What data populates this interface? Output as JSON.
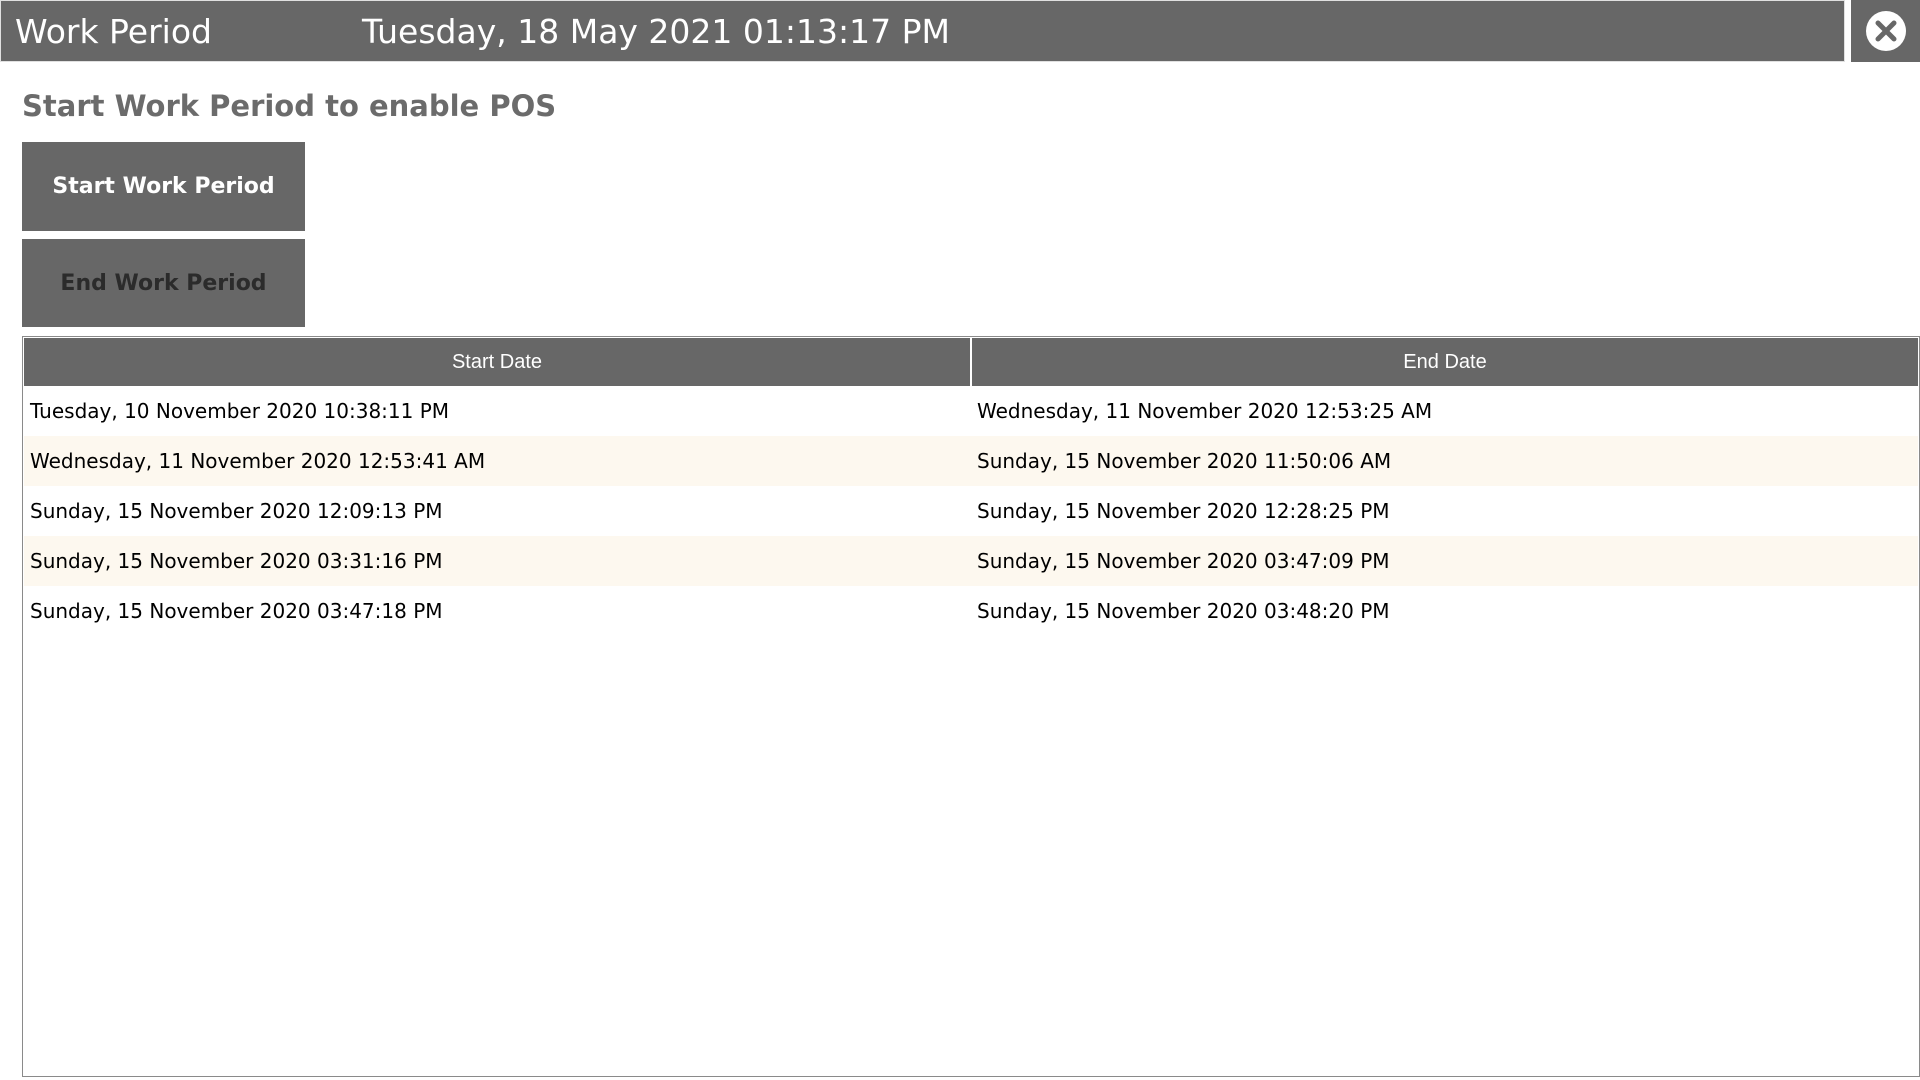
{
  "titlebar": {
    "title": "Work Period",
    "datetime": "Tuesday, 18 May 2021 01:13:17 PM"
  },
  "icons": {
    "close": "close-icon"
  },
  "subtitle": "Start Work Period to enable POS",
  "buttons": {
    "start": "Start Work Period",
    "end": "End Work Period"
  },
  "colors": {
    "header_bg": "#676767",
    "alt_row_bg": "#fdf8ef"
  },
  "table": {
    "columns": [
      "Start Date",
      "End Date"
    ],
    "rows": [
      [
        "Tuesday, 10 November 2020 10:38:11 PM",
        "Wednesday, 11 November 2020 12:53:25 AM"
      ],
      [
        "Wednesday, 11 November 2020 12:53:41 AM",
        "Sunday, 15 November 2020 11:50:06 AM"
      ],
      [
        "Sunday, 15 November 2020 12:09:13 PM",
        "Sunday, 15 November 2020 12:28:25 PM"
      ],
      [
        "Sunday, 15 November 2020 03:31:16 PM",
        "Sunday, 15 November 2020 03:47:09 PM"
      ],
      [
        "Sunday, 15 November 2020 03:47:18 PM",
        "Sunday, 15 November 2020 03:48:20 PM"
      ]
    ]
  }
}
